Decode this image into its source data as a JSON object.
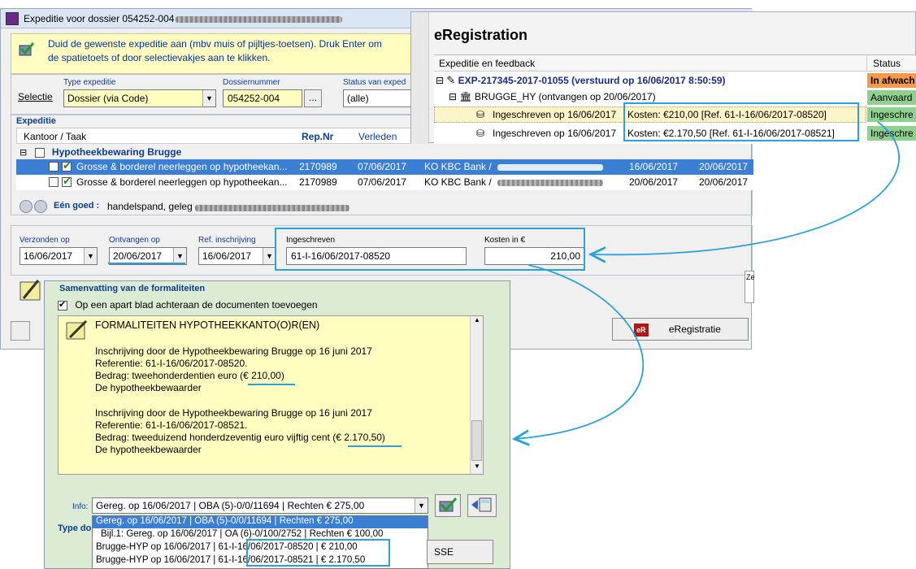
{
  "main_window": {
    "title": "Expeditie voor dossier 054252-004",
    "info_line1": "Duid de gewenste expeditie aan (mbv muis of pijltjes-toetsen). Druk Enter om",
    "info_line2": "de spatietoets of door selectievakjes aan te klikken.",
    "selectie_label": "Selectie",
    "type_label": "Type expeditie",
    "type_value": "Dossier (via Code)",
    "dossier_label": "Dossiernummer",
    "dossier_value": "054252-004",
    "dossier_btn": "...",
    "status_label": "Status van exped",
    "status_value": "(alle)",
    "expeditie_group": "Expeditie",
    "cols": {
      "kantoor": "Kantoor / Taak",
      "repnr": "Rep.Nr",
      "verleden": "Verleden"
    },
    "group_row": "Hypotheekbewaring Brugge",
    "rows": [
      {
        "task": "Grosse & borderel neerleggen op hypotheekan...",
        "repnr": "2170989",
        "verleden": "07/06/2017",
        "party": "KO KBC Bank /",
        "d1": "16/06/2017",
        "d2": "20/06/2017"
      },
      {
        "task": "Grosse & borderel neerleggen op hypotheekan...",
        "repnr": "2170989",
        "verleden": "07/06/2017",
        "party": "KO KBC Bank /",
        "d1": "20/06/2017",
        "d2": "20/06/2017"
      }
    ],
    "goed_label": "Eén goed :",
    "goed_value": "handelspand, geleg",
    "verzonden_label": "Verzonden op",
    "verzonden_value": "16/06/2017",
    "ontvangen_label": "Ontvangen op",
    "ontvangen_value": "20/06/2017",
    "refinschr_label": "Ref. inschrijving",
    "refinschr_value": "16/06/2017",
    "ingeschreven_label": "Ingeschreven",
    "ingeschreven_value": "61-I-16/06/2017-08520",
    "kosten_label": "Kosten in €",
    "kosten_value": "210,00",
    "ereg_button": "eRegistratie",
    "ereg_icon": "eR",
    "ze_label": "Ze"
  },
  "ereg_window": {
    "title": "eRegistration",
    "col_feedback": "Expeditie en feedback",
    "col_status": "Status",
    "tree": [
      {
        "text": "EXP-217345-2017-01055 (verstuurd op 16/06/2017 8:50:59)",
        "status": "In afwach"
      },
      {
        "text": "BRUGGE_HY (ontvangen op 20/06/2017)",
        "status": "Aanvaard"
      },
      {
        "text": "Ingeschreven op 16/06/2017",
        "kosten": "Kosten: €210,00  [Ref. 61-I-16/06/2017-08520]",
        "status": "Ingeschre"
      },
      {
        "text": "Ingeschreven op 16/06/2017",
        "kosten": "Kosten: €2.170,50  [Ref. 61-I-16/06/2017-08521]",
        "status": "Ingeschre"
      }
    ]
  },
  "summary_window": {
    "title": "Samenvatting van de formaliteiten",
    "checkbox_label": "Op een apart blad achteraan de documenten toevoegen",
    "heading": "FORMALITEITEN HYPOTHEEKKANTO(O)R(EN)",
    "p1_l1": "Inschrijving door de Hypotheekbewaring Brugge op 16 juni 2017",
    "p1_l2": "Referentie: 61-I-16/06/2017-08520.",
    "p1_l3a": "Bedrag: tweehonderdentien euro ",
    "p1_l3b": "(€ 210,00)",
    "p1_l4": "De hypotheekbewaarder",
    "p2_l1": "Inschrijving door de Hypotheekbewaring Brugge op 16 juni 2017",
    "p2_l2": "Referentie: 61-I-16/06/2017-08521.",
    "p2_l3a": "Bedrag: tweeduizend honderdzeventig euro vijftig cent ",
    "p2_l3b": "(€ 2.170,50)",
    "p2_l4": "De hypotheekbewaarder",
    "info_label": "Info:",
    "info_value": "Gereg. op 16/06/2017 | OBA (5)-0/0/11694 | Rechten € 275,00",
    "dropdown": [
      "Gereg. op 16/06/2017 | OBA (5)-0/0/11694 | Rechten € 275,00",
      "Bijl.1:  Gereg. op 16/06/2017 | OA (6)-0/100/2752 | Rechten € 100,00",
      "Brugge-HYP op 16/06/2017 | 61-I-16/06/2017-08520 | € 210,00",
      "Brugge-HYP op 16/06/2017 | 61-I-16/06/2017-08521 | € 2.170,50"
    ],
    "type_label": "Type do",
    "sse_text": "SSE"
  }
}
